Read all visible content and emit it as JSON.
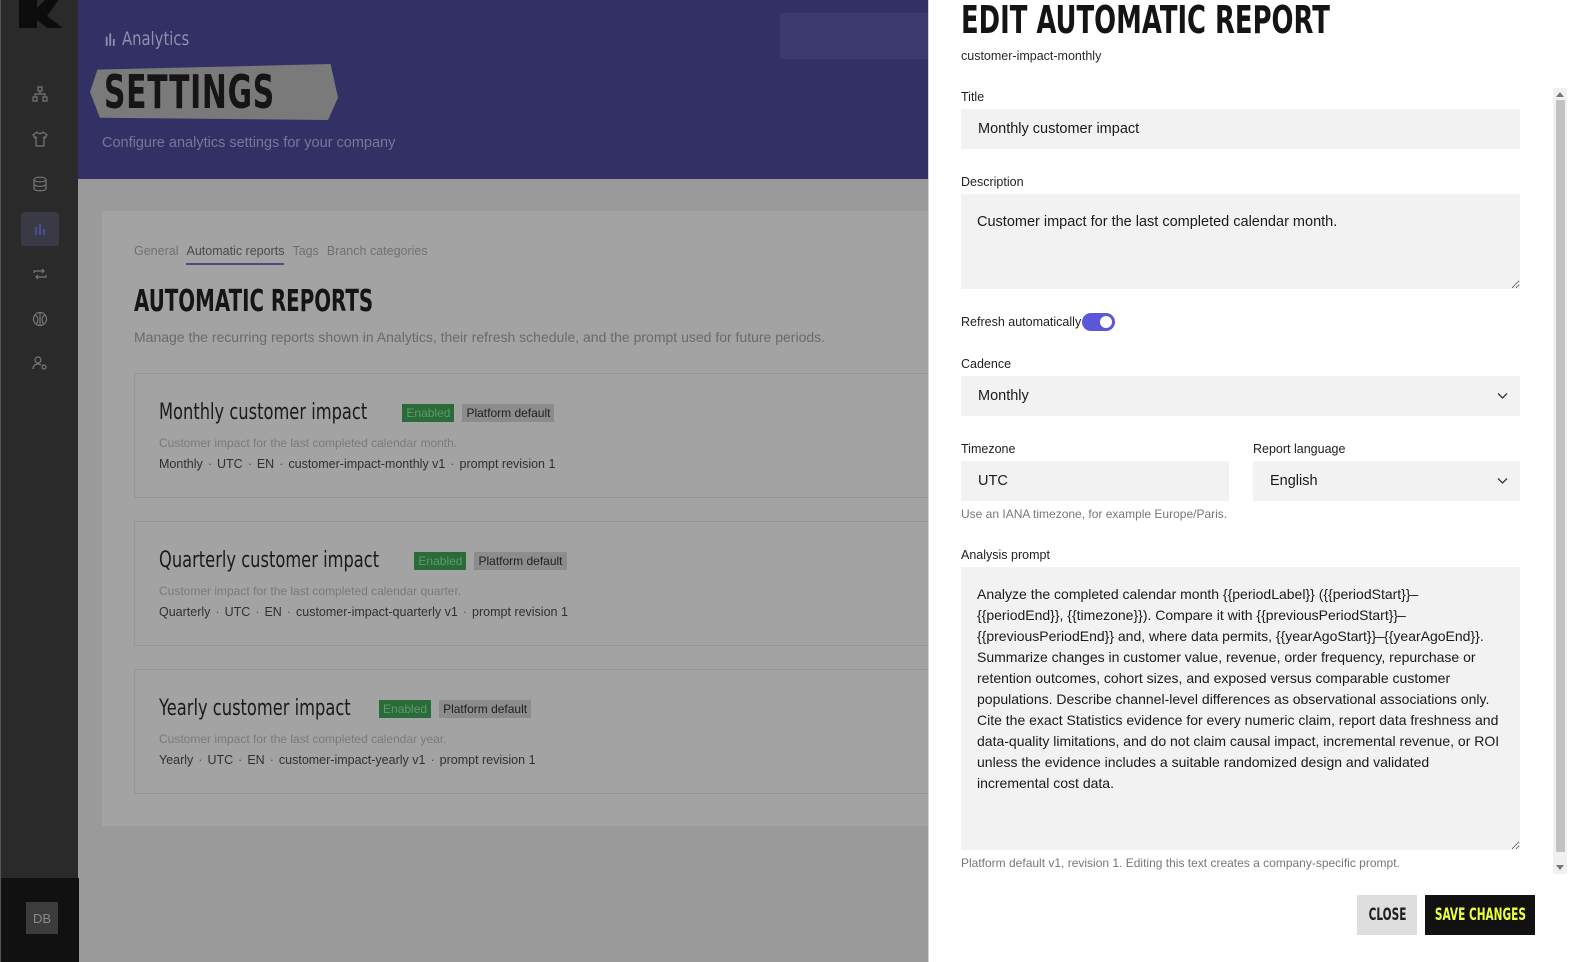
{
  "sidebar": {
    "logo": "K",
    "items": [
      {
        "icon": "sitemap-icon"
      },
      {
        "icon": "shirt-icon"
      },
      {
        "icon": "database-icon"
      },
      {
        "icon": "bar-chart-icon",
        "active": true
      },
      {
        "icon": "repeat-icon"
      },
      {
        "icon": "globe-icon"
      },
      {
        "icon": "user-settings-icon"
      }
    ],
    "avatar": "DB"
  },
  "header": {
    "breadcrumb": "Analytics",
    "title": "SETTINGS",
    "subtitle": "Configure analytics settings for your company"
  },
  "tabs": [
    "General",
    "Automatic reports",
    "Tags",
    "Branch categories"
  ],
  "section": {
    "title": "AUTOMATIC REPORTS",
    "description": "Manage the recurring reports shown in Analytics, their refresh schedule, and the prompt used for future periods."
  },
  "reports": [
    {
      "name": "Monthly customer impact",
      "status": "Enabled",
      "tag": "Platform default",
      "description": "Customer impact for the last completed calendar month.",
      "meta": [
        "Monthly",
        "UTC",
        "EN",
        "customer-impact-monthly v1",
        "prompt revision 1"
      ]
    },
    {
      "name": "Quarterly customer impact",
      "status": "Enabled",
      "tag": "Platform default",
      "description": "Customer impact for the last completed calendar quarter.",
      "meta": [
        "Quarterly",
        "UTC",
        "EN",
        "customer-impact-quarterly v1",
        "prompt revision 1"
      ]
    },
    {
      "name": "Yearly customer impact",
      "status": "Enabled",
      "tag": "Platform default",
      "description": "Customer impact for the last completed calendar year.",
      "meta": [
        "Yearly",
        "UTC",
        "EN",
        "customer-impact-yearly v1",
        "prompt revision 1"
      ]
    }
  ],
  "dialog": {
    "title": "EDIT AUTOMATIC REPORT",
    "slug": "customer-impact-monthly",
    "title_label": "Title",
    "title_value": "Monthly customer impact",
    "description_label": "Description",
    "description_value": "Customer impact for the last completed calendar month.",
    "refresh_label": "Refresh automatically",
    "refresh_on": true,
    "cadence_label": "Cadence",
    "cadence_value": "Monthly",
    "timezone_label": "Timezone",
    "timezone_value": "UTC",
    "timezone_hint": "Use an IANA timezone, for example Europe/Paris.",
    "language_label": "Report language",
    "language_value": "English",
    "prompt_label": "Analysis prompt",
    "prompt_value": "Analyze the completed calendar month {{periodLabel}} ({{periodStart}}–{{periodEnd}}, {{timezone}}). Compare it with {{previousPeriodStart}}–{{previousPeriodEnd}} and, where data permits, {{yearAgoStart}}–{{yearAgoEnd}}. Summarize changes in customer value, revenue, order frequency, repurchase or retention outcomes, cohort sizes, and exposed versus comparable customer populations. Describe channel-level differences as observational associations only. Cite the exact Statistics evidence for every numeric claim, report data freshness and data-quality limitations, and do not claim causal impact, incremental revenue, or ROI unless the evidence includes a suitable randomized design and validated incremental cost data.",
    "prompt_hint": "Platform default v1, revision 1. Editing this text creates a company-specific prompt.",
    "close_label": "CLOSE",
    "save_label": "SAVE CHANGES"
  },
  "colors": {
    "accent": "#5a57d9",
    "header_bg": "#323064",
    "save_text": "#ecff3b",
    "enabled_badge": "#2b6b3a"
  }
}
